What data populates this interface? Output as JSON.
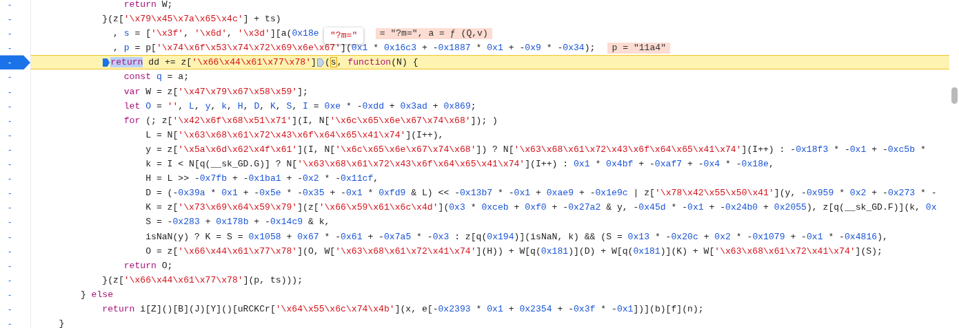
{
  "lines": [
    {
      "gutter": "-",
      "current": false,
      "kind": "body",
      "tokens": [
        {
          "kind": "keyword",
          "text": "return"
        },
        {
          "kind": "plain",
          "text": " W;"
        }
      ]
    },
    {
      "gutter": "-",
      "current": false,
      "kind": "statement",
      "tokens": [
        {
          "kind": "plain",
          "text": "}(z["
        },
        {
          "kind": "string",
          "text": "'\\x79\\x45\\x7a\\x65\\x4c'"
        },
        {
          "kind": "plain",
          "text": "] + ts)"
        }
      ]
    },
    {
      "gutter": "-",
      "current": false,
      "kind": "continuation",
      "tokens": [
        {
          "kind": "plain",
          "text": ", "
        },
        {
          "kind": "definition",
          "text": "s"
        },
        {
          "kind": "plain",
          "text": " = ["
        },
        {
          "kind": "string",
          "text": "'\\x3f'"
        },
        {
          "kind": "plain",
          "text": ", "
        },
        {
          "kind": "string",
          "text": "'\\x6d'"
        },
        {
          "kind": "plain",
          "text": ", "
        },
        {
          "kind": "string",
          "text": "'\\x3d'"
        },
        {
          "kind": "plain",
          "text": "][a("
        },
        {
          "kind": "number",
          "text": "0x18e"
        }
      ],
      "annotation": {
        "kind": "overlapped",
        "text": "= \"?m=\", a = ƒ (Q,v)"
      }
    },
    {
      "gutter": "-",
      "current": false,
      "kind": "continuation",
      "tokens": [
        {
          "kind": "plain",
          "text": ", "
        },
        {
          "kind": "definition",
          "text": "p"
        },
        {
          "kind": "plain",
          "text": " = p["
        },
        {
          "kind": "string",
          "text": "'\\x74\\x6f\\x53\\x74\\x72\\x69\\x6e\\x67'"
        },
        {
          "kind": "plain",
          "text": "]("
        },
        {
          "kind": "number",
          "text": "0x1"
        },
        {
          "kind": "plain",
          "text": " * "
        },
        {
          "kind": "number",
          "text": "0x16c3"
        },
        {
          "kind": "plain",
          "text": " + -"
        },
        {
          "kind": "number",
          "text": "0x1887"
        },
        {
          "kind": "plain",
          "text": " * "
        },
        {
          "kind": "number",
          "text": "0x1"
        },
        {
          "kind": "plain",
          "text": " + -"
        },
        {
          "kind": "number",
          "text": "0x9"
        },
        {
          "kind": "plain",
          "text": " * -"
        },
        {
          "kind": "number",
          "text": "0x34"
        },
        {
          "kind": "plain",
          "text": ");"
        }
      ],
      "annotation": {
        "kind": "inline",
        "text": "p = \"11a4\""
      }
    },
    {
      "gutter": "-",
      "current": true,
      "kind": "statement",
      "tokens": [
        {
          "kind": "pausemarker"
        },
        {
          "kind": "selection",
          "text": "return"
        },
        {
          "kind": "plain",
          "text": " dd += z["
        },
        {
          "kind": "string",
          "text": "'\\x66\\x44\\x61\\x77\\x78'"
        },
        {
          "kind": "plain",
          "text": "]"
        },
        {
          "kind": "marker"
        },
        {
          "kind": "plain",
          "text": "("
        },
        {
          "kind": "focus",
          "text": "s"
        },
        {
          "kind": "plain",
          "text": ", "
        },
        {
          "kind": "keyword",
          "text": "function"
        },
        {
          "kind": "plain",
          "text": "(N) {"
        }
      ]
    },
    {
      "gutter": "-",
      "current": false,
      "kind": "body",
      "tokens": [
        {
          "kind": "keyword",
          "text": "const "
        },
        {
          "kind": "definition",
          "text": "q"
        },
        {
          "kind": "plain",
          "text": " = a;"
        }
      ]
    },
    {
      "gutter": "-",
      "current": false,
      "kind": "body",
      "tokens": [
        {
          "kind": "keyword",
          "text": "var"
        },
        {
          "kind": "plain",
          "text": " W = z["
        },
        {
          "kind": "string",
          "text": "'\\x47\\x79\\x67\\x58\\x59'"
        },
        {
          "kind": "plain",
          "text": "];"
        }
      ]
    },
    {
      "gutter": "-",
      "current": false,
      "kind": "body",
      "tokens": [
        {
          "kind": "keyword",
          "text": "let "
        },
        {
          "kind": "definition",
          "text": "O"
        },
        {
          "kind": "plain",
          "text": " = "
        },
        {
          "kind": "string",
          "text": "''"
        },
        {
          "kind": "plain",
          "text": ", "
        },
        {
          "kind": "definition",
          "text": "L"
        },
        {
          "kind": "plain",
          "text": ", "
        },
        {
          "kind": "definition",
          "text": "y"
        },
        {
          "kind": "plain",
          "text": ", "
        },
        {
          "kind": "definition",
          "text": "k"
        },
        {
          "kind": "plain",
          "text": ", "
        },
        {
          "kind": "definition",
          "text": "H"
        },
        {
          "kind": "plain",
          "text": ", "
        },
        {
          "kind": "definition",
          "text": "D"
        },
        {
          "kind": "plain",
          "text": ", "
        },
        {
          "kind": "definition",
          "text": "K"
        },
        {
          "kind": "plain",
          "text": ", "
        },
        {
          "kind": "definition",
          "text": "S"
        },
        {
          "kind": "plain",
          "text": ", "
        },
        {
          "kind": "definition",
          "text": "I"
        },
        {
          "kind": "plain",
          "text": " = "
        },
        {
          "kind": "number",
          "text": "0xe"
        },
        {
          "kind": "plain",
          "text": " * -"
        },
        {
          "kind": "number",
          "text": "0xdd"
        },
        {
          "kind": "plain",
          "text": " + "
        },
        {
          "kind": "number",
          "text": "0x3ad"
        },
        {
          "kind": "plain",
          "text": " + "
        },
        {
          "kind": "number",
          "text": "0x869"
        },
        {
          "kind": "plain",
          "text": ";"
        }
      ]
    },
    {
      "gutter": "-",
      "current": false,
      "kind": "body",
      "tokens": [
        {
          "kind": "keyword",
          "text": "for"
        },
        {
          "kind": "plain",
          "text": " (; z["
        },
        {
          "kind": "string",
          "text": "'\\x42\\x6f\\x68\\x51\\x71'"
        },
        {
          "kind": "plain",
          "text": "](I, N["
        },
        {
          "kind": "string",
          "text": "'\\x6c\\x65\\x6e\\x67\\x74\\x68'"
        },
        {
          "kind": "plain",
          "text": "]); )"
        }
      ]
    },
    {
      "gutter": "-",
      "current": false,
      "kind": "loop",
      "tokens": [
        {
          "kind": "plain",
          "text": "L = N["
        },
        {
          "kind": "string",
          "text": "'\\x63\\x68\\x61\\x72\\x43\\x6f\\x64\\x65\\x41\\x74'"
        },
        {
          "kind": "plain",
          "text": "](I++),"
        }
      ]
    },
    {
      "gutter": "-",
      "current": false,
      "kind": "loop",
      "tokens": [
        {
          "kind": "plain",
          "text": "y = z["
        },
        {
          "kind": "string",
          "text": "'\\x5a\\x6d\\x62\\x4f\\x61'"
        },
        {
          "kind": "plain",
          "text": "](I, N["
        },
        {
          "kind": "string",
          "text": "'\\x6c\\x65\\x6e\\x67\\x74\\x68'"
        },
        {
          "kind": "plain",
          "text": "]) ? N["
        },
        {
          "kind": "string",
          "text": "'\\x63\\x68\\x61\\x72\\x43\\x6f\\x64\\x65\\x41\\x74'"
        },
        {
          "kind": "plain",
          "text": "](I++) : -"
        },
        {
          "kind": "number",
          "text": "0x18f3"
        },
        {
          "kind": "plain",
          "text": " * -"
        },
        {
          "kind": "number",
          "text": "0x1"
        },
        {
          "kind": "plain",
          "text": " + -"
        },
        {
          "kind": "number",
          "text": "0xc5b"
        },
        {
          "kind": "plain",
          "text": " *"
        }
      ]
    },
    {
      "gutter": "-",
      "current": false,
      "kind": "loop",
      "tokens": [
        {
          "kind": "plain",
          "text": "k = I < N[q(__sk_GD.G)] ? N["
        },
        {
          "kind": "string",
          "text": "'\\x63\\x68\\x61\\x72\\x43\\x6f\\x64\\x65\\x41\\x74'"
        },
        {
          "kind": "plain",
          "text": "](I++) : "
        },
        {
          "kind": "number",
          "text": "0x1"
        },
        {
          "kind": "plain",
          "text": " * "
        },
        {
          "kind": "number",
          "text": "0x4bf"
        },
        {
          "kind": "plain",
          "text": " + -"
        },
        {
          "kind": "number",
          "text": "0xaf7"
        },
        {
          "kind": "plain",
          "text": " + -"
        },
        {
          "kind": "number",
          "text": "0x4"
        },
        {
          "kind": "plain",
          "text": " * -"
        },
        {
          "kind": "number",
          "text": "0x18e"
        },
        {
          "kind": "plain",
          "text": ","
        }
      ]
    },
    {
      "gutter": "-",
      "current": false,
      "kind": "loop",
      "tokens": [
        {
          "kind": "plain",
          "text": "H = L >> -"
        },
        {
          "kind": "number",
          "text": "0x7fb"
        },
        {
          "kind": "plain",
          "text": " + -"
        },
        {
          "kind": "number",
          "text": "0x1ba1"
        },
        {
          "kind": "plain",
          "text": " + -"
        },
        {
          "kind": "number",
          "text": "0x2"
        },
        {
          "kind": "plain",
          "text": " * -"
        },
        {
          "kind": "number",
          "text": "0x11cf"
        },
        {
          "kind": "plain",
          "text": ","
        }
      ]
    },
    {
      "gutter": "-",
      "current": false,
      "kind": "loop",
      "tokens": [
        {
          "kind": "plain",
          "text": "D = (-"
        },
        {
          "kind": "number",
          "text": "0x39a"
        },
        {
          "kind": "plain",
          "text": " * "
        },
        {
          "kind": "number",
          "text": "0x1"
        },
        {
          "kind": "plain",
          "text": " + -"
        },
        {
          "kind": "number",
          "text": "0x5e"
        },
        {
          "kind": "plain",
          "text": " * -"
        },
        {
          "kind": "number",
          "text": "0x35"
        },
        {
          "kind": "plain",
          "text": " + -"
        },
        {
          "kind": "number",
          "text": "0x1"
        },
        {
          "kind": "plain",
          "text": " * "
        },
        {
          "kind": "number",
          "text": "0xfd9"
        },
        {
          "kind": "plain",
          "text": " & L) << -"
        },
        {
          "kind": "number",
          "text": "0x13b7"
        },
        {
          "kind": "plain",
          "text": " * -"
        },
        {
          "kind": "number",
          "text": "0x1"
        },
        {
          "kind": "plain",
          "text": " + "
        },
        {
          "kind": "number",
          "text": "0xae9"
        },
        {
          "kind": "plain",
          "text": " + -"
        },
        {
          "kind": "number",
          "text": "0x1e9c"
        },
        {
          "kind": "plain",
          "text": " | z["
        },
        {
          "kind": "string",
          "text": "'\\x78\\x42\\x55\\x50\\x41'"
        },
        {
          "kind": "plain",
          "text": "](y, -"
        },
        {
          "kind": "number",
          "text": "0x959"
        },
        {
          "kind": "plain",
          "text": " * "
        },
        {
          "kind": "number",
          "text": "0x2"
        },
        {
          "kind": "plain",
          "text": " + -"
        },
        {
          "kind": "number",
          "text": "0x273"
        },
        {
          "kind": "plain",
          "text": " * -"
        }
      ]
    },
    {
      "gutter": "-",
      "current": false,
      "kind": "loop",
      "tokens": [
        {
          "kind": "plain",
          "text": "K = z["
        },
        {
          "kind": "string",
          "text": "'\\x73\\x69\\x64\\x59\\x79'"
        },
        {
          "kind": "plain",
          "text": "](z["
        },
        {
          "kind": "string",
          "text": "'\\x66\\x59\\x61\\x6c\\x4d'"
        },
        {
          "kind": "plain",
          "text": "]("
        },
        {
          "kind": "number",
          "text": "0x3"
        },
        {
          "kind": "plain",
          "text": " * "
        },
        {
          "kind": "number",
          "text": "0xceb"
        },
        {
          "kind": "plain",
          "text": " + "
        },
        {
          "kind": "number",
          "text": "0xf0"
        },
        {
          "kind": "plain",
          "text": " + -"
        },
        {
          "kind": "number",
          "text": "0x27a2"
        },
        {
          "kind": "plain",
          "text": " & y, -"
        },
        {
          "kind": "number",
          "text": "0x45d"
        },
        {
          "kind": "plain",
          "text": " * -"
        },
        {
          "kind": "number",
          "text": "0x1"
        },
        {
          "kind": "plain",
          "text": " + -"
        },
        {
          "kind": "number",
          "text": "0x24b0"
        },
        {
          "kind": "plain",
          "text": " + "
        },
        {
          "kind": "number",
          "text": "0x2055"
        },
        {
          "kind": "plain",
          "text": "), z[q(__sk_GD.F)](k, "
        },
        {
          "kind": "number",
          "text": "0x"
        }
      ]
    },
    {
      "gutter": "-",
      "current": false,
      "kind": "loop",
      "tokens": [
        {
          "kind": "plain",
          "text": "S = -"
        },
        {
          "kind": "number",
          "text": "0x283"
        },
        {
          "kind": "plain",
          "text": " + "
        },
        {
          "kind": "number",
          "text": "0x178b"
        },
        {
          "kind": "plain",
          "text": " + -"
        },
        {
          "kind": "number",
          "text": "0x14c9"
        },
        {
          "kind": "plain",
          "text": " & k,"
        }
      ]
    },
    {
      "gutter": "-",
      "current": false,
      "kind": "loop",
      "tokens": [
        {
          "kind": "plain",
          "text": "isNaN(y) ? K = S = "
        },
        {
          "kind": "number",
          "text": "0x1058"
        },
        {
          "kind": "plain",
          "text": " + "
        },
        {
          "kind": "number",
          "text": "0x67"
        },
        {
          "kind": "plain",
          "text": " * -"
        },
        {
          "kind": "number",
          "text": "0x61"
        },
        {
          "kind": "plain",
          "text": " + -"
        },
        {
          "kind": "number",
          "text": "0x7a5"
        },
        {
          "kind": "plain",
          "text": " * -"
        },
        {
          "kind": "number",
          "text": "0x3"
        },
        {
          "kind": "plain",
          "text": " : z[q("
        },
        {
          "kind": "number",
          "text": "0x194"
        },
        {
          "kind": "plain",
          "text": ")](isNaN, k) && (S = "
        },
        {
          "kind": "number",
          "text": "0x13"
        },
        {
          "kind": "plain",
          "text": " * -"
        },
        {
          "kind": "number",
          "text": "0x20c"
        },
        {
          "kind": "plain",
          "text": " + "
        },
        {
          "kind": "number",
          "text": "0x2"
        },
        {
          "kind": "plain",
          "text": " * -"
        },
        {
          "kind": "number",
          "text": "0x1079"
        },
        {
          "kind": "plain",
          "text": " + -"
        },
        {
          "kind": "number",
          "text": "0x1"
        },
        {
          "kind": "plain",
          "text": " * -"
        },
        {
          "kind": "number",
          "text": "0x4816"
        },
        {
          "kind": "plain",
          "text": "),"
        }
      ]
    },
    {
      "gutter": "-",
      "current": false,
      "kind": "loop",
      "tokens": [
        {
          "kind": "plain",
          "text": "O = z["
        },
        {
          "kind": "string",
          "text": "'\\x66\\x44\\x61\\x77\\x78'"
        },
        {
          "kind": "plain",
          "text": "](O, W["
        },
        {
          "kind": "string",
          "text": "'\\x63\\x68\\x61\\x72\\x41\\x74'"
        },
        {
          "kind": "plain",
          "text": "](H)) + W[q("
        },
        {
          "kind": "number",
          "text": "0x181"
        },
        {
          "kind": "plain",
          "text": ")](D) + W[q("
        },
        {
          "kind": "number",
          "text": "0x181"
        },
        {
          "kind": "plain",
          "text": ")](K) + W["
        },
        {
          "kind": "string",
          "text": "'\\x63\\x68\\x61\\x72\\x41\\x74'"
        },
        {
          "kind": "plain",
          "text": "](S);"
        }
      ]
    },
    {
      "gutter": "-",
      "current": false,
      "kind": "body",
      "tokens": [
        {
          "kind": "keyword",
          "text": "return"
        },
        {
          "kind": "plain",
          "text": " O;"
        }
      ]
    },
    {
      "gutter": "-",
      "current": false,
      "kind": "statement",
      "tokens": [
        {
          "kind": "plain",
          "text": "}(z["
        },
        {
          "kind": "string",
          "text": "'\\x66\\x44\\x61\\x77\\x78'"
        },
        {
          "kind": "plain",
          "text": "](p, ts)));"
        }
      ]
    },
    {
      "gutter": "-",
      "current": false,
      "kind": "branch",
      "tokens": [
        {
          "kind": "plain",
          "text": "} "
        },
        {
          "kind": "keyword",
          "text": "else"
        }
      ]
    },
    {
      "gutter": "-",
      "current": false,
      "kind": "statement",
      "tokens": [
        {
          "kind": "keyword",
          "text": "return"
        },
        {
          "kind": "plain",
          "text": " i[Z]()[B](J)[Y]()[uRCKCr["
        },
        {
          "kind": "string",
          "text": "'\\x64\\x55\\x6c\\x74\\x4b'"
        },
        {
          "kind": "plain",
          "text": "](x, e[-"
        },
        {
          "kind": "number",
          "text": "0x2393"
        },
        {
          "kind": "plain",
          "text": " * "
        },
        {
          "kind": "number",
          "text": "0x1"
        },
        {
          "kind": "plain",
          "text": " + "
        },
        {
          "kind": "number",
          "text": "0x2354"
        },
        {
          "kind": "plain",
          "text": " + -"
        },
        {
          "kind": "number",
          "text": "0x3f"
        },
        {
          "kind": "plain",
          "text": " * -"
        },
        {
          "kind": "number",
          "text": "0x1"
        },
        {
          "kind": "plain",
          "text": "])](b)[f](n);"
        }
      ]
    },
    {
      "gutter": "-",
      "current": false,
      "kind": "outer",
      "tokens": [
        {
          "kind": "plain",
          "text": "}"
        }
      ]
    }
  ],
  "tooltip": {
    "text": "\"?m=\""
  }
}
